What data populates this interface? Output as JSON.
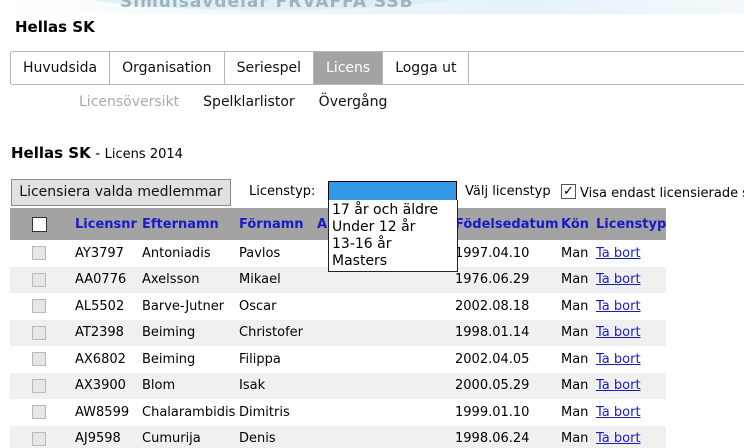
{
  "banner": {
    "text": "Simulsavdelar FRVAFFA SSB"
  },
  "club_title": "Hellas SK",
  "nav": {
    "items": [
      {
        "label": "Huvudsida",
        "active": false
      },
      {
        "label": "Organisation",
        "active": false
      },
      {
        "label": "Seriespel",
        "active": false
      },
      {
        "label": "Licens",
        "active": true
      },
      {
        "label": "Logga ut",
        "active": false
      }
    ]
  },
  "subnav": {
    "items": [
      {
        "label": "Licensöversikt",
        "current": true
      },
      {
        "label": "Spelklarlistor",
        "current": false
      },
      {
        "label": "Övergång",
        "current": false
      }
    ]
  },
  "section": {
    "club": "Hellas SK",
    "separator": " - ",
    "season": "Licens 2014"
  },
  "toolbar": {
    "license_button": "Licensiera valda medlemmar",
    "license_type_label": "Licenstyp:",
    "license_type_value": "",
    "choose_label": "Välj licenstyp",
    "filter_checked": true,
    "filter_label": "Visa endast licensierade s"
  },
  "dropdown": {
    "options": [
      "17 år och äldre",
      "Under 12 år",
      "13-16 år",
      "Masters"
    ]
  },
  "table": {
    "headers": {
      "licensnr": "Licensnr",
      "efternamn": "Efternamn",
      "fornamn": "Förnamn",
      "a": "A",
      "fodelsedatum": "Födelsedatum",
      "kon": "Kön",
      "licenstyp": "Licenstyp"
    },
    "rows": [
      {
        "nr": "AY3797",
        "last": "Antoniadis",
        "first": "Pavlos",
        "birth": "1997.04.10",
        "sex": "Man",
        "action": "Ta bort"
      },
      {
        "nr": "AA0776",
        "last": "Axelsson",
        "first": "Mikael",
        "birth": "1976.06.29",
        "sex": "Man",
        "action": "Ta bort"
      },
      {
        "nr": "AL5502",
        "last": "Barve-Jutner",
        "first": "Oscar",
        "birth": "2002.08.18",
        "sex": "Man",
        "action": "Ta bort"
      },
      {
        "nr": "AT2398",
        "last": "Beiming",
        "first": "Christofer",
        "birth": "1998.01.14",
        "sex": "Man",
        "action": "Ta bort"
      },
      {
        "nr": "AX6802",
        "last": "Beiming",
        "first": "Filippa",
        "birth": "2002.04.05",
        "sex": "Man",
        "action": "Ta bort"
      },
      {
        "nr": "AX3900",
        "last": "Blom",
        "first": "Isak",
        "birth": "2000.05.29",
        "sex": "Man",
        "action": "Ta bort"
      },
      {
        "nr": "AW8599",
        "last": "Chalarambidis",
        "first": "Dimitris",
        "birth": "1999.01.10",
        "sex": "Man",
        "action": "Ta bort"
      },
      {
        "nr": "AJ9598",
        "last": "Cumurija",
        "first": "Denis",
        "birth": "1998.06.24",
        "sex": "Man",
        "action": "Ta bort"
      }
    ]
  },
  "colors": {
    "nav_active_bg": "#a3a3a3",
    "header_text": "#1a1ac8",
    "select_highlight": "#3399e6",
    "link": "#1a1ac8"
  }
}
